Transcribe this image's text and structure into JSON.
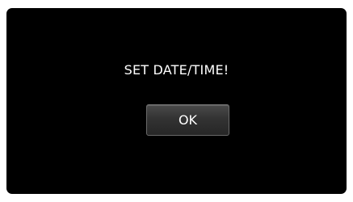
{
  "dialog": {
    "message": "SET DATE/TIME!",
    "ok_label": "OK"
  },
  "colors": {
    "screen_background": "#000000",
    "text": "#ffffff",
    "button_face": "#333333",
    "button_border": "#6a6a6a"
  }
}
